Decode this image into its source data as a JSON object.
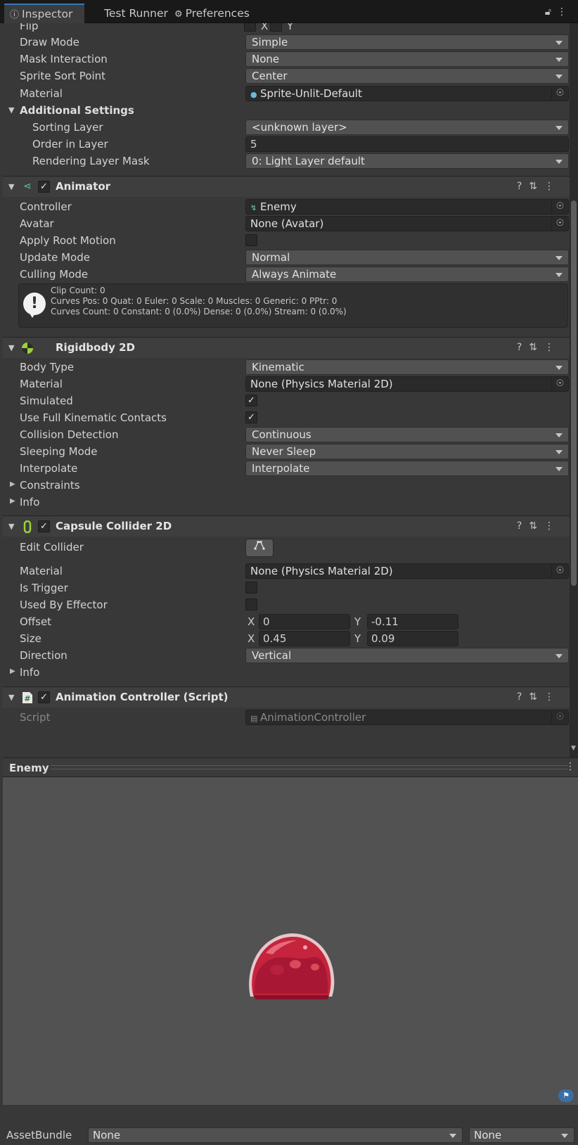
{
  "tabs": [
    {
      "label": "Inspector",
      "icon": "info-icon"
    },
    {
      "label": "Test Runner"
    },
    {
      "label": "Preferences",
      "icon": "gear-icon"
    }
  ],
  "sprite_renderer": {
    "flip": {
      "label": "Flip",
      "x": "X",
      "y": "Y"
    },
    "draw_mode": {
      "label": "Draw Mode",
      "value": "Simple"
    },
    "mask_interaction": {
      "label": "Mask Interaction",
      "value": "None"
    },
    "sprite_sort_point": {
      "label": "Sprite Sort Point",
      "value": "Center"
    },
    "material": {
      "label": "Material",
      "value": "Sprite-Unlit-Default"
    },
    "additional_settings": "Additional Settings",
    "sorting_layer": {
      "label": "Sorting Layer",
      "value": "<unknown layer>"
    },
    "order_in_layer": {
      "label": "Order in Layer",
      "value": "5"
    },
    "rendering_layer_mask": {
      "label": "Rendering Layer Mask",
      "value": "0: Light Layer default"
    }
  },
  "animator": {
    "title": "Animator",
    "enabled": true,
    "controller": {
      "label": "Controller",
      "value": "Enemy"
    },
    "avatar": {
      "label": "Avatar",
      "value": "None (Avatar)"
    },
    "apply_root_motion": {
      "label": "Apply Root Motion",
      "checked": false
    },
    "update_mode": {
      "label": "Update Mode",
      "value": "Normal"
    },
    "culling_mode": {
      "label": "Culling Mode",
      "value": "Always Animate"
    },
    "info_lines": [
      "Clip Count: 0",
      "Curves Pos: 0 Quat: 0 Euler: 0 Scale: 0 Muscles: 0 Generic: 0 PPtr: 0",
      "Curves Count: 0 Constant: 0 (0.0%) Dense: 0 (0.0%) Stream: 0 (0.0%)"
    ]
  },
  "rigidbody": {
    "title": "Rigidbody 2D",
    "body_type": {
      "label": "Body Type",
      "value": "Kinematic"
    },
    "material": {
      "label": "Material",
      "value": "None (Physics Material 2D)"
    },
    "simulated": {
      "label": "Simulated",
      "checked": true
    },
    "full_kinematic": {
      "label": "Use Full Kinematic Contacts",
      "checked": true
    },
    "collision_detection": {
      "label": "Collision Detection",
      "value": "Continuous"
    },
    "sleeping_mode": {
      "label": "Sleeping Mode",
      "value": "Never Sleep"
    },
    "interpolate": {
      "label": "Interpolate",
      "value": "Interpolate"
    },
    "constraints": "Constraints",
    "info": "Info"
  },
  "capsule": {
    "title": "Capsule Collider 2D",
    "enabled": true,
    "edit_collider": "Edit Collider",
    "material": {
      "label": "Material",
      "value": "None (Physics Material 2D)"
    },
    "is_trigger": {
      "label": "Is Trigger",
      "checked": false
    },
    "used_by_effector": {
      "label": "Used By Effector",
      "checked": false
    },
    "offset": {
      "label": "Offset",
      "x_label": "X",
      "x": "0",
      "y_label": "Y",
      "y": "-0.11"
    },
    "size": {
      "label": "Size",
      "x_label": "X",
      "x": "0.45",
      "y_label": "Y",
      "y": "0.09"
    },
    "direction": {
      "label": "Direction",
      "value": "Vertical"
    },
    "info": "Info"
  },
  "anim_controller": {
    "title": "Animation Controller (Script)",
    "enabled": true,
    "script": {
      "label": "Script",
      "value": "AnimationController"
    }
  },
  "preview": {
    "title": "Enemy"
  },
  "asset_bundle": {
    "label": "AssetBundle",
    "name": "None",
    "variant": "None"
  },
  "colors": {
    "accent": "#3a79bb",
    "slime": "#c4243c",
    "component_icon_green": "#9ad13a"
  }
}
